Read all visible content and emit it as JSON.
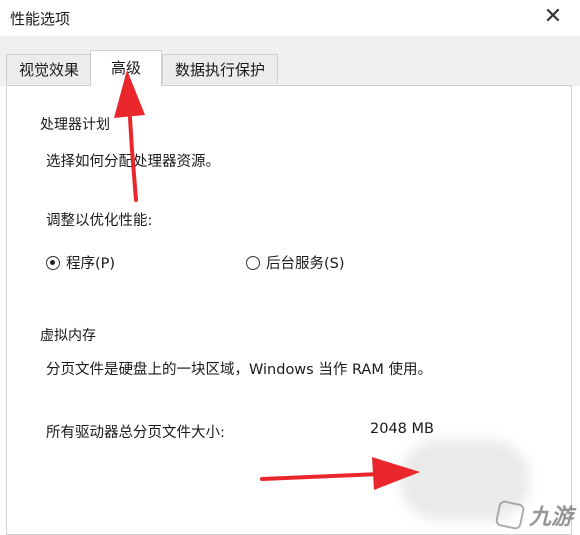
{
  "window": {
    "title": "性能选项",
    "close_glyph": "✕"
  },
  "tabs": [
    {
      "label": "视觉效果",
      "active": false
    },
    {
      "label": "高级",
      "active": true
    },
    {
      "label": "数据执行保护",
      "active": false
    }
  ],
  "processor_group": {
    "title": "处理器计划",
    "description": "选择如何分配处理器资源。",
    "adjust_label": "调整以优化性能:",
    "options": [
      {
        "label": "程序(P)",
        "selected": true
      },
      {
        "label": "后台服务(S)",
        "selected": false
      }
    ]
  },
  "virtual_memory_group": {
    "title": "虚拟内存",
    "description": "分页文件是硬盘上的一块区域，Windows 当作 RAM 使用。",
    "total_label": "所有驱动器总分页文件大小:",
    "total_value": "2048 MB"
  },
  "watermark": {
    "text": "九游"
  },
  "colors": {
    "annotation_arrow": "#e8262b",
    "tab_bg": "#ececec",
    "panel_border": "#cfcfcf"
  }
}
